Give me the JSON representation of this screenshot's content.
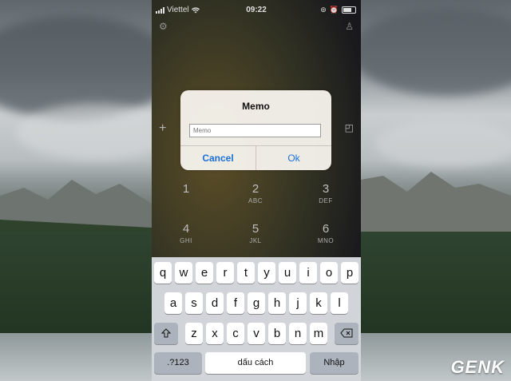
{
  "status_bar": {
    "carrier": "Viettel",
    "time": "09:22"
  },
  "alert": {
    "title": "Memo",
    "input_placeholder": "Memo",
    "input_value": "",
    "cancel_label": "Cancel",
    "ok_label": "Ok"
  },
  "dialpad": [
    {
      "digit": "1",
      "letters": ""
    },
    {
      "digit": "2",
      "letters": "ABC"
    },
    {
      "digit": "3",
      "letters": "DEF"
    },
    {
      "digit": "4",
      "letters": "GHI"
    },
    {
      "digit": "5",
      "letters": "JKL"
    },
    {
      "digit": "6",
      "letters": "MNO"
    }
  ],
  "keyboard": {
    "row1": [
      "q",
      "w",
      "e",
      "r",
      "t",
      "y",
      "u",
      "i",
      "o",
      "p"
    ],
    "row2": [
      "a",
      "s",
      "d",
      "f",
      "g",
      "h",
      "j",
      "k",
      "l"
    ],
    "row3": [
      "z",
      "x",
      "c",
      "v",
      "b",
      "n",
      "m"
    ],
    "numbers_key": ".?123",
    "space_key": "dấu cách",
    "return_key": "Nhập",
    "shift_icon": "shift-icon",
    "delete_icon": "delete-icon"
  },
  "watermark": "GENK",
  "icons": {
    "top_left": "gear-icon",
    "top_right": "person-icon",
    "left": "plus-icon",
    "right": "note-icon"
  },
  "colors": {
    "link_blue": "#1a6ed8",
    "keyboard_bg": "#d1d4d9",
    "alert_bg": "#f6f2ec"
  }
}
